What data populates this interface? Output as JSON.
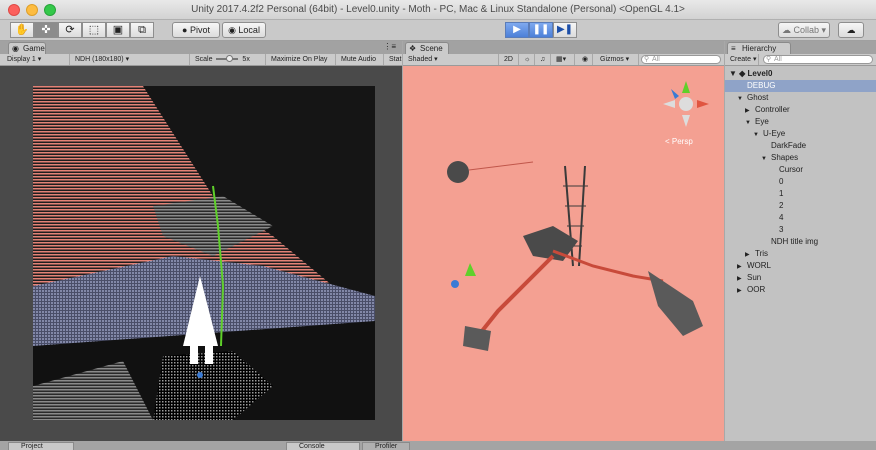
{
  "window": {
    "title": "Unity 2017.4.2f2 Personal (64bit) - Level0.unity - Moth - PC, Mac & Linux Standalone (Personal) <OpenGL 4.1>"
  },
  "toolbar": {
    "pivot_label": "Pivot",
    "local_label": "Local",
    "collab_label": "Collab ▾",
    "play_icon": "▶",
    "pause_icon": "❚❚",
    "step_icon": "▶❚",
    "tools": [
      "✋",
      "✜",
      "⟳",
      "⬚",
      "▣",
      "⧉"
    ]
  },
  "game": {
    "tab_label": "Game",
    "display": "Display 1",
    "resolution": "NDH (180x180)",
    "scale_label": "Scale",
    "scale_value": "5x",
    "maximize": "Maximize On Play",
    "mute": "Mute Audio",
    "stats": "Stat"
  },
  "scene": {
    "tab_label": "Scene",
    "shading": "Shaded",
    "mode_2d": "2D",
    "gizmos": "Gizmos ▾",
    "search_placeholder": "All",
    "persp_label": "< Persp"
  },
  "hierarchy": {
    "tab_label": "Hierarchy",
    "create": "Create ▾",
    "search_placeholder": "All",
    "scene_name": "Level0",
    "items": [
      {
        "label": "DEBUG",
        "indent": 1,
        "arrow": "",
        "selected": true
      },
      {
        "label": "Ghost",
        "indent": 1,
        "arrow": "▼"
      },
      {
        "label": "Controller",
        "indent": 2,
        "arrow": "▶"
      },
      {
        "label": "Eye",
        "indent": 2,
        "arrow": "▼"
      },
      {
        "label": "U-Eye",
        "indent": 3,
        "arrow": "▼"
      },
      {
        "label": "DarkFade",
        "indent": 4,
        "arrow": ""
      },
      {
        "label": "Shapes",
        "indent": 4,
        "arrow": "▼"
      },
      {
        "label": "Cursor",
        "indent": 5,
        "arrow": ""
      },
      {
        "label": "0",
        "indent": 5,
        "arrow": ""
      },
      {
        "label": "1",
        "indent": 5,
        "arrow": ""
      },
      {
        "label": "2",
        "indent": 5,
        "arrow": ""
      },
      {
        "label": "4",
        "indent": 5,
        "arrow": ""
      },
      {
        "label": "3",
        "indent": 5,
        "arrow": ""
      },
      {
        "label": "NDH title img",
        "indent": 4,
        "arrow": ""
      },
      {
        "label": "Tris",
        "indent": 2,
        "arrow": "▶"
      },
      {
        "label": "WORL",
        "indent": 1,
        "arrow": "▶"
      },
      {
        "label": "Sun",
        "indent": 1,
        "arrow": "▶"
      },
      {
        "label": "OOR",
        "indent": 1,
        "arrow": "▶"
      }
    ]
  },
  "bottom": {
    "project": "Project",
    "console": "Console",
    "profiler": "Profiler"
  },
  "colors": {
    "scene_bg": "#f4a092",
    "game_stripe": "#e48276",
    "selection": "#8fa3c8"
  }
}
